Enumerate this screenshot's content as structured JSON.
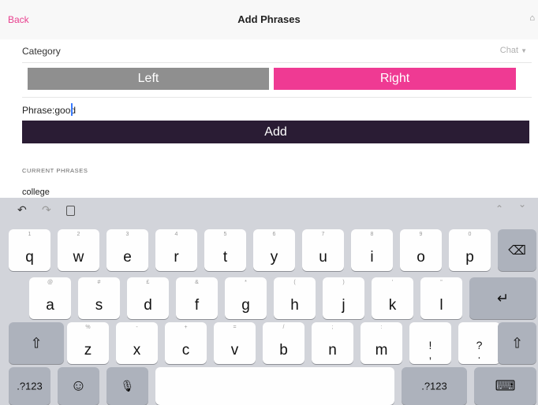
{
  "nav": {
    "back": "Back",
    "title": "Add Phrases",
    "home_icon": "home-icon"
  },
  "category": {
    "label": "Category",
    "value": "Chat"
  },
  "segment": {
    "left": "Left",
    "right": "Right"
  },
  "phrase": {
    "label": "Phrase:",
    "value": "good"
  },
  "add_button": "Add",
  "current_phrases": {
    "heading": "CURRENT PHRASES",
    "items": [
      "college"
    ]
  },
  "toolbar": {
    "undo": "↶",
    "redo": "↷",
    "paste": "paste-icon",
    "up": "⌃",
    "down": "⌄"
  },
  "keyboard": {
    "row1": [
      {
        "ch": "q",
        "hint": "1"
      },
      {
        "ch": "w",
        "hint": "2"
      },
      {
        "ch": "e",
        "hint": "3"
      },
      {
        "ch": "r",
        "hint": "4"
      },
      {
        "ch": "t",
        "hint": "5"
      },
      {
        "ch": "y",
        "hint": "6"
      },
      {
        "ch": "u",
        "hint": "7"
      },
      {
        "ch": "i",
        "hint": "8"
      },
      {
        "ch": "o",
        "hint": "9"
      },
      {
        "ch": "p",
        "hint": "0"
      }
    ],
    "row2": [
      {
        "ch": "a",
        "hint": "@"
      },
      {
        "ch": "s",
        "hint": "#"
      },
      {
        "ch": "d",
        "hint": "£"
      },
      {
        "ch": "f",
        "hint": "&"
      },
      {
        "ch": "g",
        "hint": "*"
      },
      {
        "ch": "h",
        "hint": "("
      },
      {
        "ch": "j",
        "hint": ")"
      },
      {
        "ch": "k",
        "hint": "'"
      },
      {
        "ch": "l",
        "hint": "\""
      }
    ],
    "row3": [
      {
        "ch": "z",
        "hint": "%"
      },
      {
        "ch": "x",
        "hint": "-"
      },
      {
        "ch": "c",
        "hint": "+"
      },
      {
        "ch": "v",
        "hint": "="
      },
      {
        "ch": "b",
        "hint": "/"
      },
      {
        "ch": "n",
        "hint": ";"
      },
      {
        "ch": "m",
        "hint": ":"
      },
      {
        "ch": "!\n,",
        "hint": ""
      },
      {
        "ch": "?\n.",
        "hint": ""
      }
    ],
    "numbers_left": ".?123",
    "numbers_right": ".?123",
    "delete": "⌫",
    "return": "↵",
    "shift": "⇧",
    "emoji": "☺",
    "mic": "🎙",
    "hide": "⌨"
  }
}
